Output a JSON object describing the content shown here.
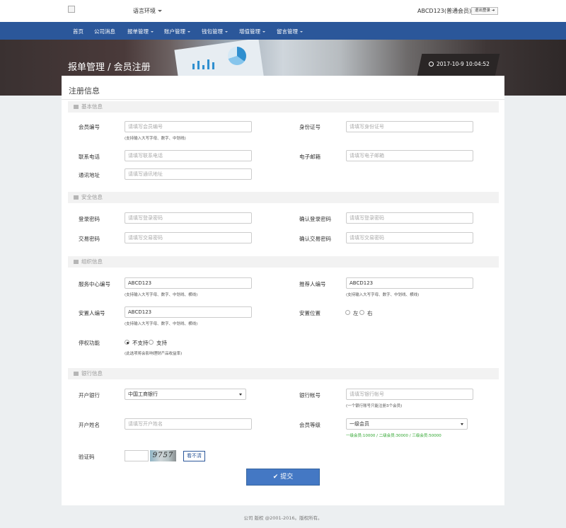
{
  "topbar": {
    "language": "语言环境",
    "user": "ABCD123(普通会员)",
    "logout": "退出登录 ➜"
  },
  "nav": {
    "items": [
      {
        "label": "首页",
        "dropdown": false
      },
      {
        "label": "公司消息",
        "dropdown": false
      },
      {
        "label": "报单管理",
        "dropdown": true
      },
      {
        "label": "账户管理",
        "dropdown": true
      },
      {
        "label": "钱包管理",
        "dropdown": true
      },
      {
        "label": "增值管理",
        "dropdown": true
      },
      {
        "label": "留言管理",
        "dropdown": true
      }
    ]
  },
  "banner": {
    "title": "报单管理 /  会员注册",
    "datetime": "2017-10-9 10:04:52"
  },
  "form": {
    "title": "注册信息",
    "sections": {
      "basic": "基本信息",
      "security": "安全信息",
      "org": "组织信息",
      "bank": "银行信息"
    },
    "fields": {
      "member_no": {
        "label": "会员编号",
        "placeholder": "请填写会员编号",
        "hint": "(支持输入大写字母、数字、中划线)"
      },
      "id_card": {
        "label": "身份证号",
        "placeholder": "请填写身份证号"
      },
      "phone": {
        "label": "联系电话",
        "placeholder": "请填写联系电话"
      },
      "email": {
        "label": "电子邮箱",
        "placeholder": "请填写电子邮箱"
      },
      "address": {
        "label": "通讯地址",
        "placeholder": "请填写通讯地址"
      },
      "login_pwd": {
        "label": "登录密码",
        "placeholder": "请填写登录密码"
      },
      "login_pwd_confirm": {
        "label": "确认登录密码",
        "placeholder": "请填写登录密码"
      },
      "trade_pwd": {
        "label": "交易密码",
        "placeholder": "请填写交易密码"
      },
      "trade_pwd_confirm": {
        "label": "确认交易密码",
        "placeholder": "请填写交易密码"
      },
      "service_center": {
        "label": "服务中心编号",
        "value": "ABCD123",
        "hint": "(支持输入大写字母、数字、中划线、横线)"
      },
      "referrer": {
        "label": "推荐人编号",
        "value": "ABCD123",
        "hint": "(支持输入大写字母、数字、中划线、横线)"
      },
      "placement": {
        "label": "安置人编号",
        "value": "ABCD123",
        "hint": "(支持输入大写字母、数字、中划线、横线)"
      },
      "position": {
        "label": "安置位置",
        "options": [
          "左",
          "右"
        ],
        "selected": null
      },
      "suspend": {
        "label": "停权功能",
        "options": [
          "不支持",
          "支持"
        ],
        "selected": "不支持",
        "hint": "(此选项将会影响理财产品收益率)"
      },
      "bank": {
        "label": "开户银行",
        "value": "中国工商银行"
      },
      "bank_account": {
        "label": "银行帐号",
        "placeholder": "请填写银行帐号",
        "hint": "(一个银行账号只能注册3个会员)"
      },
      "account_name": {
        "label": "开户姓名",
        "placeholder": "请填写开户姓名"
      },
      "member_level": {
        "label": "会员等级",
        "value": "一级会员",
        "hint": "一级会员:10000 / 二级会员:30000 / 三级会员:50000"
      },
      "captcha": {
        "label": "验证码",
        "image_text": "9757",
        "refresh": "看不清"
      }
    },
    "submit": "✔ 提交"
  },
  "footer": "公司 版权 @2001-2016。版权所有。",
  "colors": {
    "nav_bg": "#2b579a",
    "submit_bg": "#4478c4",
    "hint_green": "#2ea52e"
  }
}
